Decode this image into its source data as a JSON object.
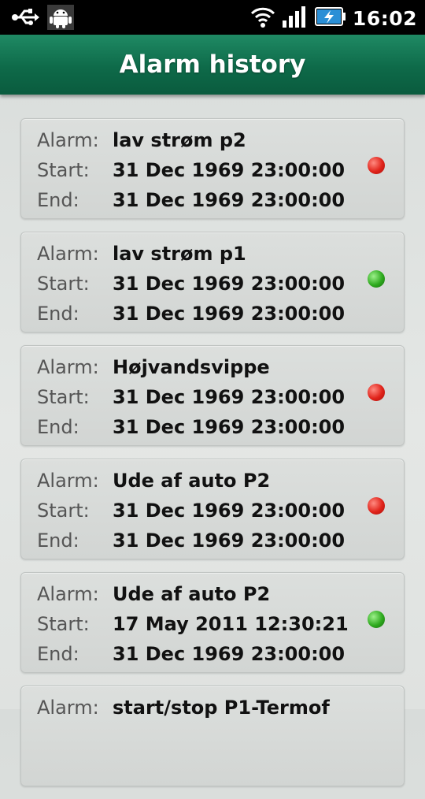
{
  "statusbar": {
    "time": "16:02",
    "icons": [
      "usb-icon",
      "android-icon",
      "wifi-icon",
      "signal-icon",
      "battery-charging-icon"
    ]
  },
  "header": {
    "title": "Alarm history"
  },
  "labels": {
    "alarm": "Alarm:",
    "start": "Start:",
    "end": "End:"
  },
  "colors": {
    "header": "#0e6a49",
    "status_red": "#e0231a",
    "status_green": "#2eaa1e"
  },
  "alarms": [
    {
      "name": "lav strøm p2",
      "start": "31 Dec 1969 23:00:00",
      "end": "31 Dec 1969 23:00:00",
      "status": "red"
    },
    {
      "name": "lav strøm p1",
      "start": "31 Dec 1969 23:00:00",
      "end": "31 Dec 1969 23:00:00",
      "status": "green"
    },
    {
      "name": "Højvandsvippe",
      "start": "31 Dec 1969 23:00:00",
      "end": "31 Dec 1969 23:00:00",
      "status": "red"
    },
    {
      "name": "Ude af auto P2",
      "start": "31 Dec 1969 23:00:00",
      "end": "31 Dec 1969 23:00:00",
      "status": "red"
    },
    {
      "name": "Ude af auto P2",
      "start": "17 May 2011 12:30:21",
      "end": "31 Dec 1969 23:00:00",
      "status": "green"
    },
    {
      "name": "start/stop P1-Termof"
    }
  ]
}
